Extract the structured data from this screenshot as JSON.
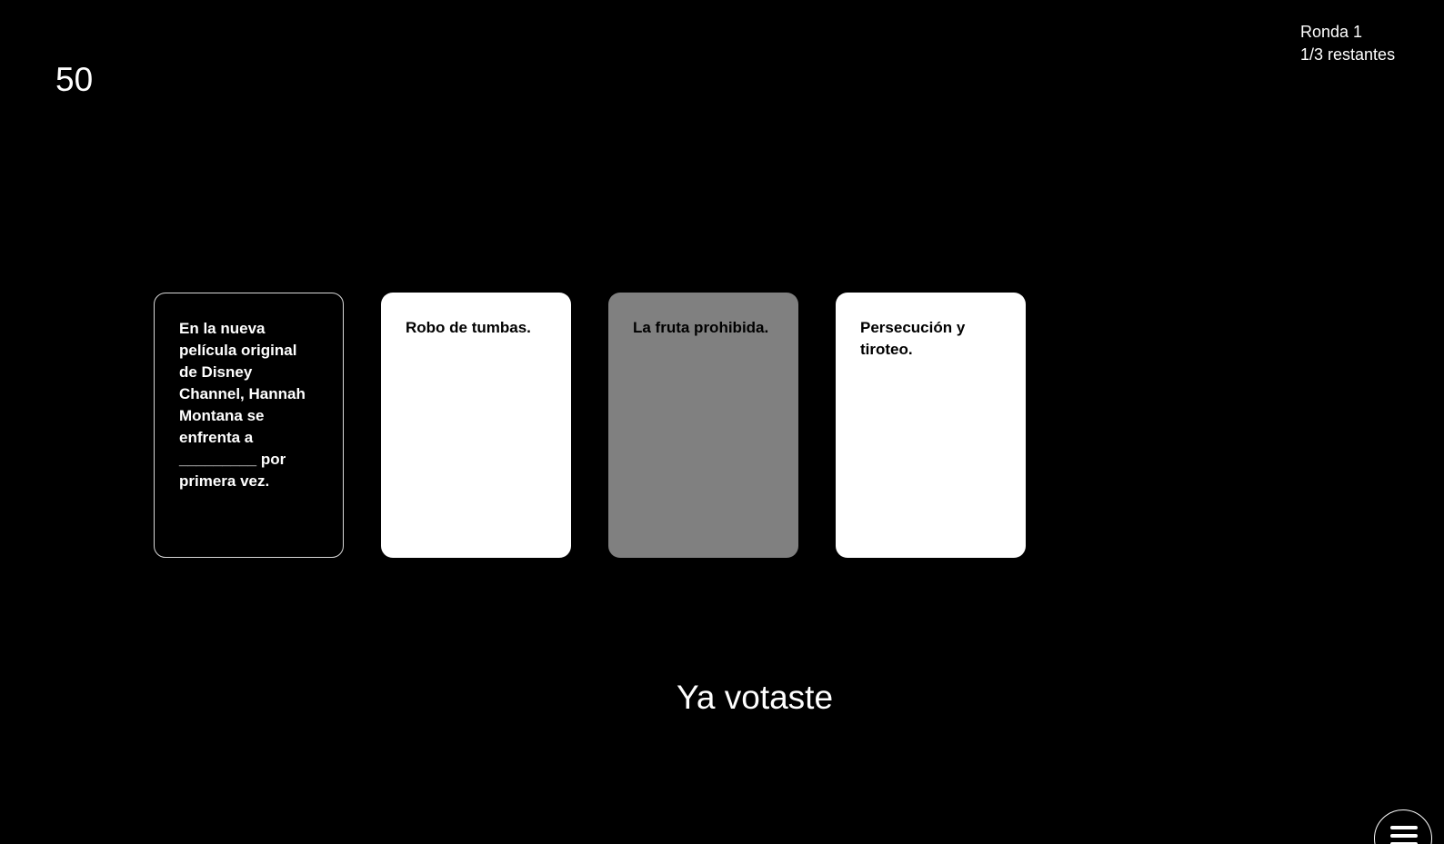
{
  "timer": "50",
  "round": {
    "label": "Ronda 1",
    "remaining": "1/3 restantes"
  },
  "black_card": {
    "text": "En la nueva película original de Disney Channel, Hannah Montana se enfrenta a _________ por primera vez."
  },
  "white_cards": [
    {
      "text": "Robo de tumbas.",
      "selected": false
    },
    {
      "text": "La fruta prohibida.",
      "selected": true
    },
    {
      "text": "Persecución y tiroteo.",
      "selected": false
    }
  ],
  "status_text": "Ya votaste",
  "menu_icon": "hamburger-menu-icon",
  "colors": {
    "background": "#000000",
    "card_white": "#ffffff",
    "card_selected": "#808080"
  }
}
